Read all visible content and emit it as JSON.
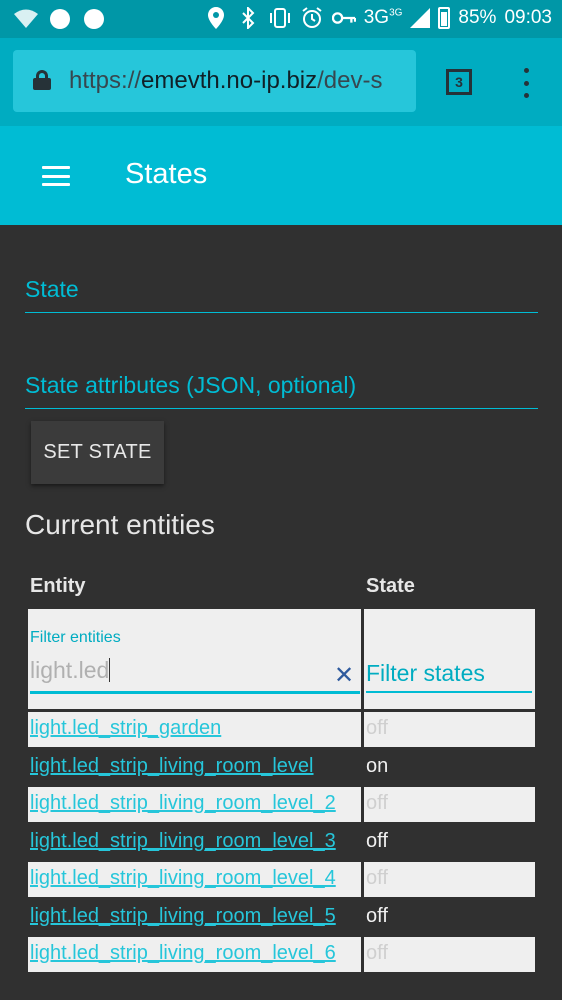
{
  "statusbar": {
    "signal_label": "3G",
    "signal_sup": "3G",
    "battery": "85%",
    "time": "09:03"
  },
  "browser": {
    "url_scheme": "https://",
    "url_host": "emevth.no-ip.biz",
    "url_rest": "/dev-s",
    "tab_count": "3"
  },
  "header": {
    "title": "States"
  },
  "form": {
    "state_label": "State",
    "attributes_label": "State attributes (JSON, optional)",
    "set_state_button": "SET STATE"
  },
  "entities": {
    "section_title": "Current entities",
    "col_entity": "Entity",
    "col_state": "State",
    "filter_entities_caption": "Filter entities",
    "filter_entities_value": "light.led",
    "filter_states_placeholder": "Filter states",
    "clear_icon": "close-icon",
    "rows": [
      {
        "entity": "light.led_strip_garden",
        "state": "off"
      },
      {
        "entity": "light.led_strip_living_room_level",
        "state": "on"
      },
      {
        "entity": "light.led_strip_living_room_level_2",
        "state": "off"
      },
      {
        "entity": "light.led_strip_living_room_level_3",
        "state": "off"
      },
      {
        "entity": "light.led_strip_living_room_level_4",
        "state": "off"
      },
      {
        "entity": "light.led_strip_living_room_level_5",
        "state": "off"
      },
      {
        "entity": "light.led_strip_living_room_level_6",
        "state": "off"
      }
    ]
  },
  "colors": {
    "accent": "#00bcd4",
    "background": "#303030",
    "statusbar": "#0097a7"
  }
}
